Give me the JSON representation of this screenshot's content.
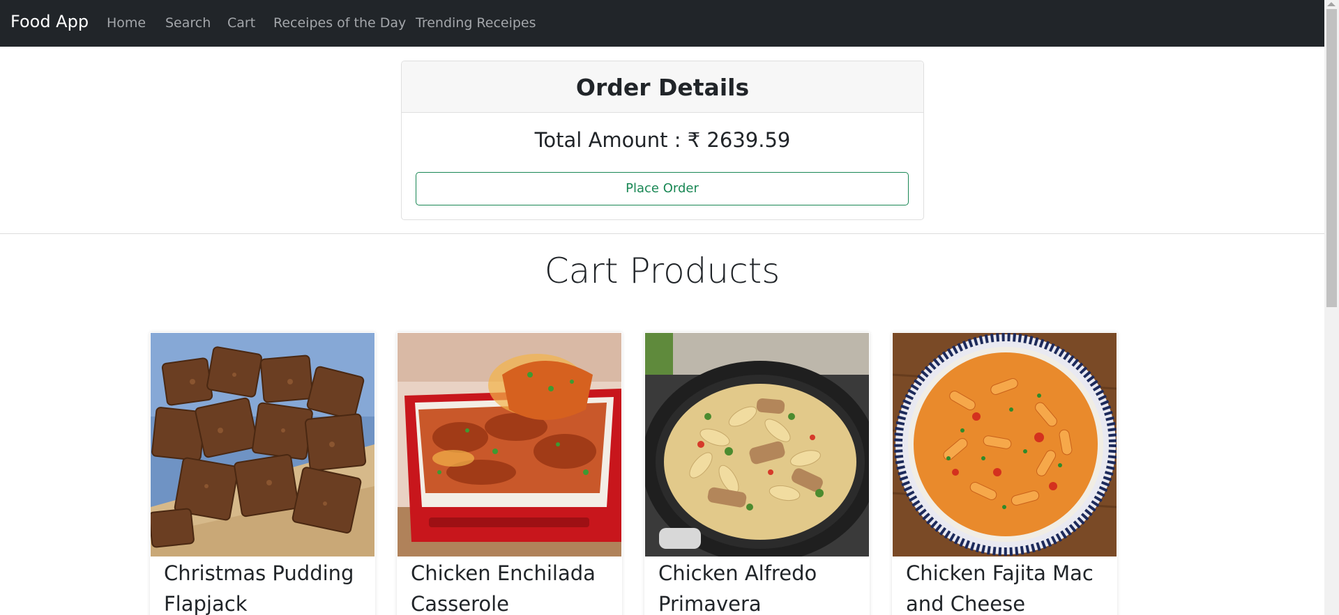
{
  "navbar": {
    "brand": "Food App",
    "links": [
      "Home",
      "Search",
      "Cart",
      "Receipes of the Day",
      "Trending Receipes"
    ]
  },
  "order": {
    "title": "Order Details",
    "total": "Total Amount : ₹ 2639.59",
    "place_order_label": "Place Order"
  },
  "cart": {
    "title": "Cart Products",
    "products": [
      {
        "name": "Christmas Pudding Flapjack"
      },
      {
        "name": "Chicken Enchilada Casserole"
      },
      {
        "name": "Chicken Alfredo Primavera"
      },
      {
        "name": "Chicken Fajita Mac and Cheese"
      }
    ]
  },
  "colors": {
    "navbar_bg": "#212529",
    "success": "#198754"
  }
}
